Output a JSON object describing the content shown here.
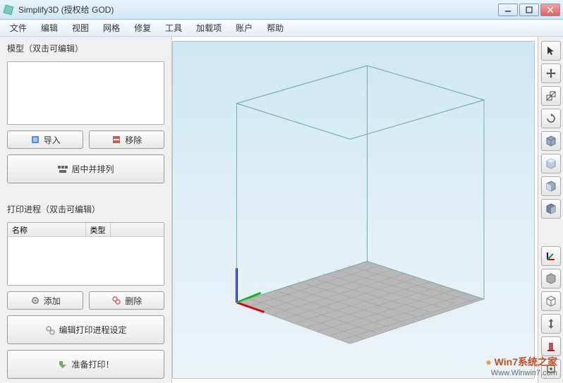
{
  "window": {
    "title": "Simplify3D (授权给 GOD)"
  },
  "menu": {
    "items": [
      "文件",
      "编辑",
      "视图",
      "网格",
      "修复",
      "工具",
      "加载项",
      "账户",
      "帮助"
    ]
  },
  "models_panel": {
    "label": "模型（双击可编辑）",
    "import_btn": "导入",
    "remove_btn": "移除",
    "center_btn": "居中并排列"
  },
  "process_panel": {
    "label": "打印进程（双击可编辑）",
    "col_name": "名称",
    "col_type": "类型",
    "add_btn": "添加",
    "delete_btn": "删除",
    "edit_btn": "编辑打印进程设定",
    "prepare_btn": "准备打印！"
  },
  "watermark": {
    "line1": "Win7系统之家",
    "line2": "Www.Winwin7.com"
  }
}
